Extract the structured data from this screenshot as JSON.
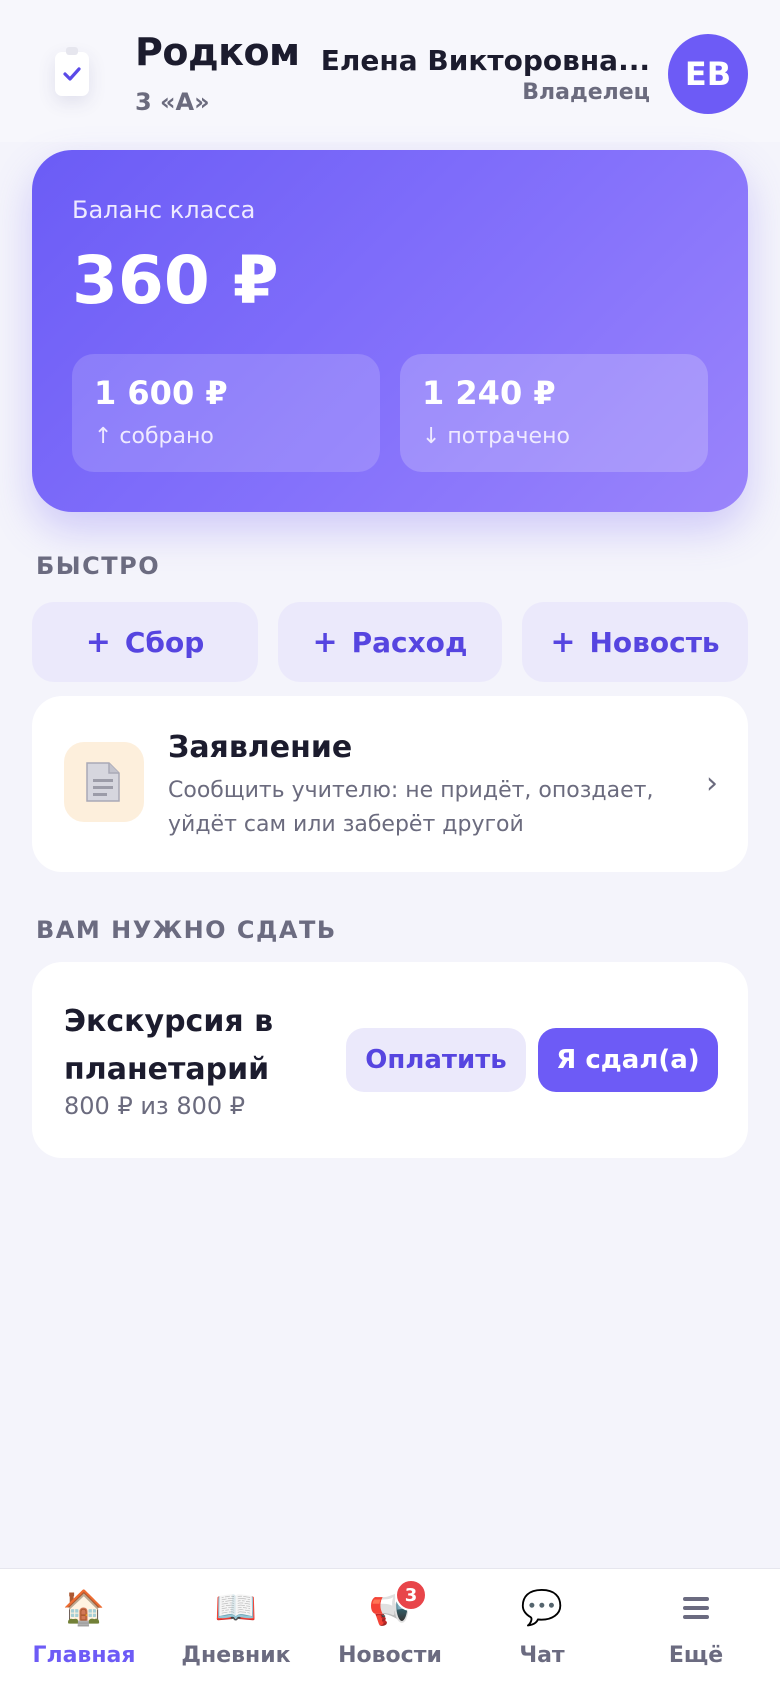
{
  "header": {
    "app_title": "Родком",
    "class_name": "3 «А»",
    "user_name": "Елена Викторовна...",
    "user_role": "Владелец",
    "avatar_initials": "ЕВ"
  },
  "balance": {
    "label": "Баланс класса",
    "value": "360 ₽",
    "collected_value": "1 600 ₽",
    "collected_label": "↑ собрано",
    "spent_value": "1 240 ₽",
    "spent_label": "↓ потрачено"
  },
  "quick": {
    "section_title": "БЫСТРО",
    "plus": "+",
    "actions": [
      {
        "label": "Сбор"
      },
      {
        "label": "Расход"
      },
      {
        "label": "Новость"
      }
    ]
  },
  "statement": {
    "title": "Заявление",
    "description": "Сообщить учителю: не придёт, опоздает, уйдёт сам или заберёт другой",
    "icon": "document-icon"
  },
  "due": {
    "section_title": "ВАМ НУЖНО СДАТЬ",
    "item_title": "Экскурсия в планетарий",
    "item_amount": "800 ₽ из 800 ₽",
    "pay_label": "Оплатить",
    "done_label": "Я сдал(а)"
  },
  "nav": {
    "items": [
      {
        "label": "Главная",
        "icon": "home-icon",
        "glyph": "🏠"
      },
      {
        "label": "Дневник",
        "icon": "book-icon",
        "glyph": "📖"
      },
      {
        "label": "Новости",
        "icon": "megaphone-icon",
        "glyph": "📢",
        "badge": "3"
      },
      {
        "label": "Чат",
        "icon": "chat-icon",
        "glyph": "💬"
      },
      {
        "label": "Ещё",
        "icon": "menu-icon",
        "glyph": "≡"
      }
    ]
  },
  "colors": {
    "accent": "#6d5bf6",
    "accent_light": "#ebe9fb",
    "badge": "#e8454a",
    "background": "#f4f4fb"
  }
}
